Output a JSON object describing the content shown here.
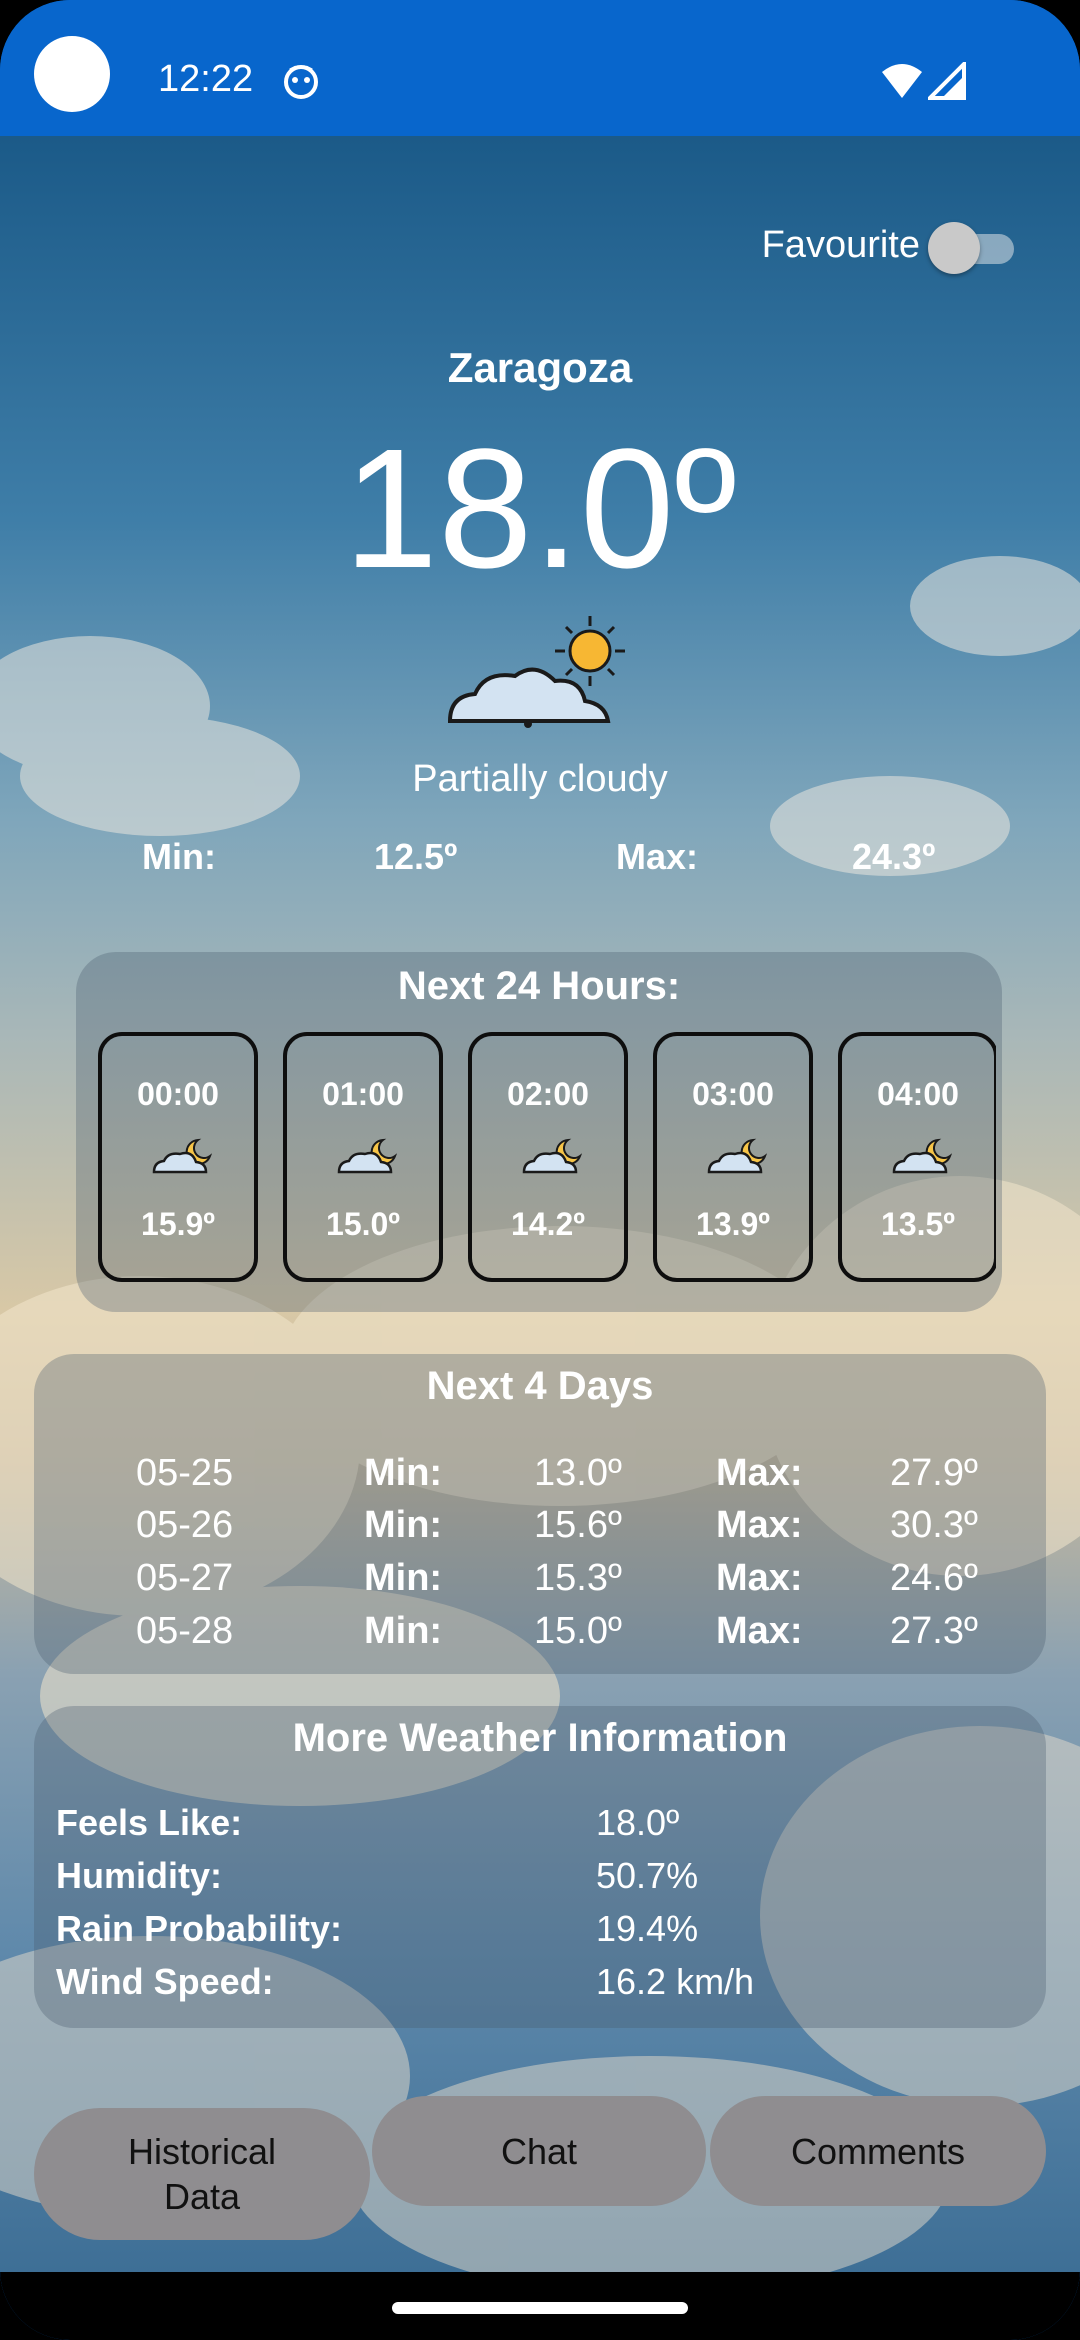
{
  "status_bar": {
    "time": "12:22",
    "icons": [
      "camera-dot",
      "app-notification-icon",
      "wifi-icon",
      "signal-icon"
    ]
  },
  "favourite": {
    "label": "Favourite",
    "on": false
  },
  "current": {
    "city": "Zaragoza",
    "temperature": "18.0º",
    "condition": "Partially cloudy",
    "icon": "partly-cloudy-sun-icon",
    "min_label": "Min:",
    "min_value": "12.5º",
    "max_label": "Max:",
    "max_value": "24.3º"
  },
  "hourly": {
    "title": "Next 24 Hours:",
    "items": [
      {
        "time": "00:00",
        "temp": "15.9º",
        "icon": "cloud-moon-icon"
      },
      {
        "time": "01:00",
        "temp": "15.0º",
        "icon": "cloud-moon-icon"
      },
      {
        "time": "02:00",
        "temp": "14.2º",
        "icon": "cloud-moon-icon"
      },
      {
        "time": "03:00",
        "temp": "13.9º",
        "icon": "cloud-moon-icon"
      },
      {
        "time": "04:00",
        "temp": "13.5º",
        "icon": "cloud-moon-icon"
      }
    ]
  },
  "daily": {
    "title": "Next 4 Days",
    "min_label": "Min:",
    "max_label": "Max:",
    "rows": [
      {
        "date": "05-25",
        "min": "13.0º",
        "max": "27.9º"
      },
      {
        "date": "05-26",
        "min": "15.6º",
        "max": "30.3º"
      },
      {
        "date": "05-27",
        "min": "15.3º",
        "max": "24.6º"
      },
      {
        "date": "05-28",
        "min": "15.0º",
        "max": "27.3º"
      }
    ]
  },
  "more_info": {
    "title": "More Weather Information",
    "rows": [
      {
        "label": "Feels Like:",
        "value": "18.0º"
      },
      {
        "label": "Humidity:",
        "value": "50.7%"
      },
      {
        "label": "Rain Probability:",
        "value": "19.4%"
      },
      {
        "label": "Wind Speed:",
        "value": "16.2 km/h"
      }
    ]
  },
  "buttons": {
    "historical_line1": "Historical",
    "historical_line2": "Data",
    "chat": "Chat",
    "comments": "Comments"
  },
  "colors": {
    "status_bar": "#0866cc",
    "button_bg": "#8f8d90",
    "card_border": "#0e0e0e"
  }
}
